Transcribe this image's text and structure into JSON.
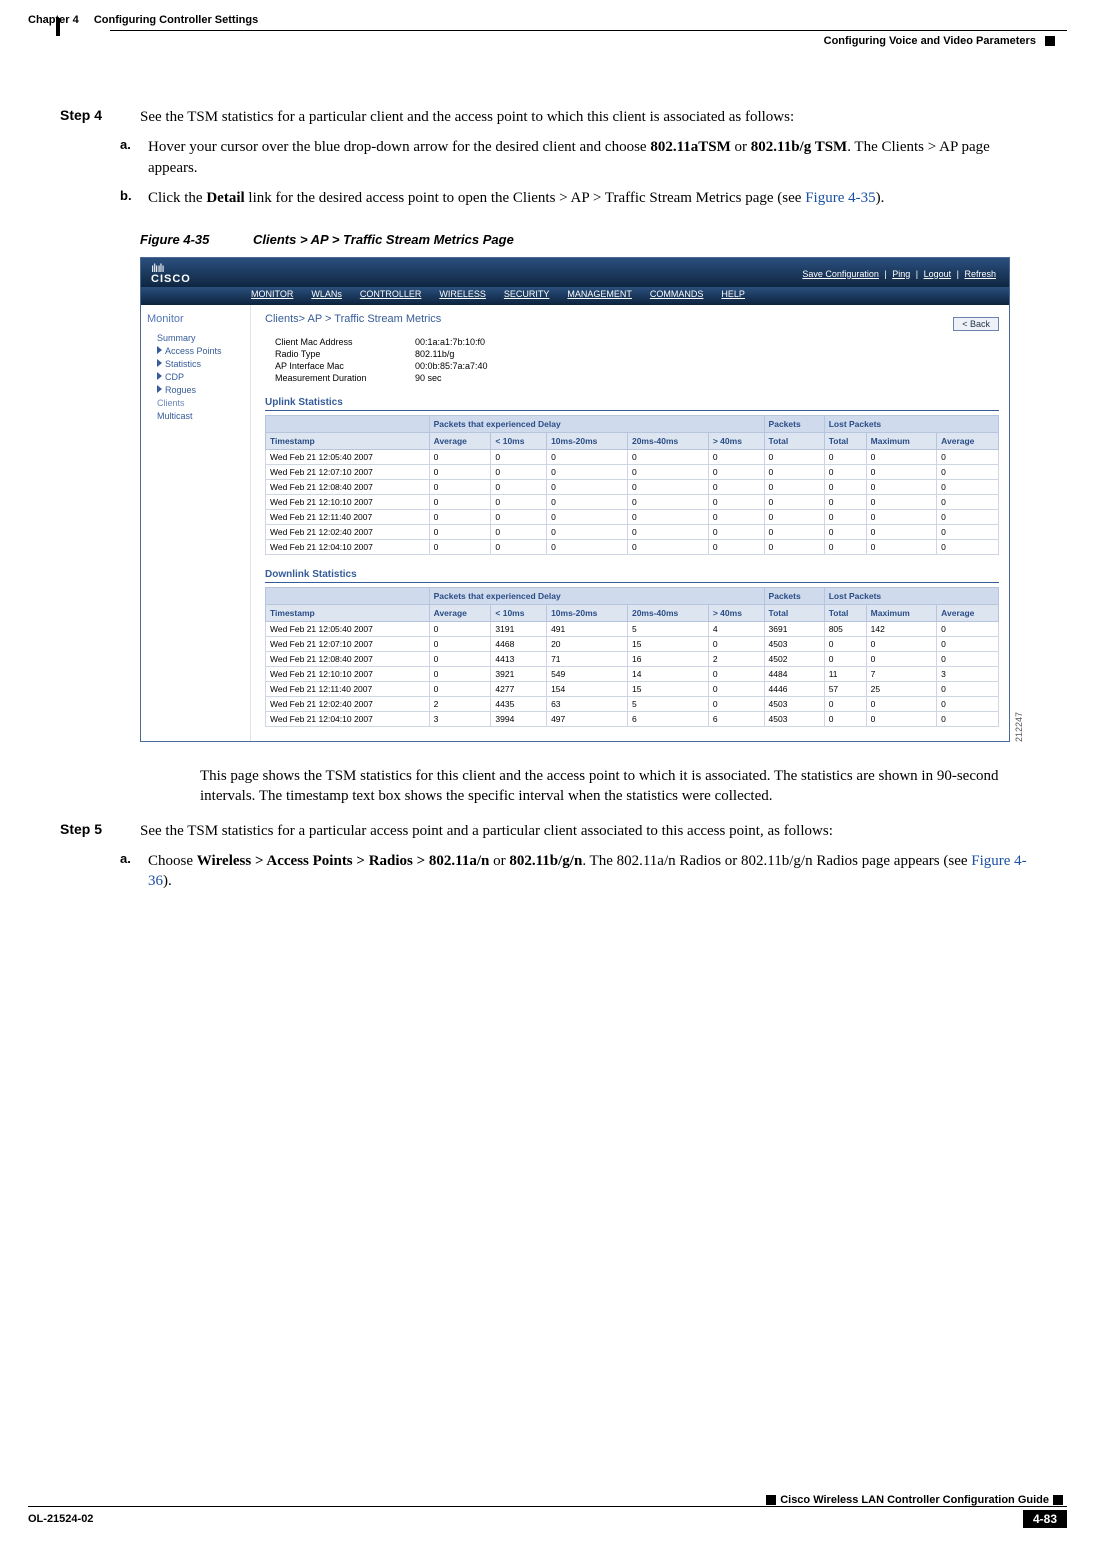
{
  "header": {
    "chapter": "Chapter 4",
    "title": "Configuring Controller Settings",
    "sub": "Configuring Voice and Video Parameters"
  },
  "step4": {
    "label": "Step 4",
    "text": "See the TSM statistics for a particular client and the access point to which this client is associated as follows:",
    "a_prefix": "Hover your cursor over the blue drop-down arrow for the desired client and choose ",
    "a_bold1": "802.11aTSM",
    "a_mid": " or ",
    "a_bold2": "802.11b/g TSM",
    "a_suffix": ". The Clients > AP page appears.",
    "b_prefix": "Click the ",
    "b_bold": "Detail",
    "b_mid": " link for the desired access point to open the Clients > AP > Traffic Stream Metrics page (see ",
    "b_link": "Figure 4-35",
    "b_suffix": ")."
  },
  "figure": {
    "num": "Figure 4-35",
    "caption": "Clients > AP > Traffic Stream Metrics Page",
    "id": "212247",
    "toplinks": {
      "save": "Save Configuration",
      "ping": "Ping",
      "logout": "Logout",
      "refresh": "Refresh"
    },
    "logo_bars": "ılıılı",
    "logo_text": "CISCO",
    "nav": [
      "MONITOR",
      "WLANs",
      "CONTROLLER",
      "WIRELESS",
      "SECURITY",
      "MANAGEMENT",
      "COMMANDS",
      "HELP"
    ],
    "side_title": "Monitor",
    "side_items": [
      "Summary",
      "Access Points",
      "Statistics",
      "CDP",
      "Rogues",
      "Clients",
      "Multicast"
    ],
    "crumb": "Clients> AP > Traffic Stream Metrics",
    "back": "< Back",
    "kv": [
      {
        "k": "Client Mac Address",
        "v": "00:1a:a1:7b:10:f0"
      },
      {
        "k": "Radio Type",
        "v": "802.11b/g"
      },
      {
        "k": "AP Interface Mac",
        "v": "00:0b:85:7a:a7:40"
      },
      {
        "k": "Measurement Duration",
        "v": "90 sec"
      }
    ],
    "uplink_title": "Uplink Statistics",
    "downlink_title": "Downlink Statistics",
    "group_headers": {
      "empty": "",
      "delay": "Packets that experienced Delay",
      "packets": "Packets",
      "lost": "Lost Packets"
    },
    "col_headers": [
      "Timestamp",
      "Average",
      "< 10ms",
      "10ms-20ms",
      "20ms-40ms",
      "> 40ms",
      "Total",
      "Total",
      "Maximum",
      "Average"
    ],
    "uplink_rows": [
      [
        "Wed Feb 21 12:05:40 2007",
        "0",
        "0",
        "0",
        "0",
        "0",
        "0",
        "0",
        "0",
        "0"
      ],
      [
        "Wed Feb 21 12:07:10 2007",
        "0",
        "0",
        "0",
        "0",
        "0",
        "0",
        "0",
        "0",
        "0"
      ],
      [
        "Wed Feb 21 12:08:40 2007",
        "0",
        "0",
        "0",
        "0",
        "0",
        "0",
        "0",
        "0",
        "0"
      ],
      [
        "Wed Feb 21 12:10:10 2007",
        "0",
        "0",
        "0",
        "0",
        "0",
        "0",
        "0",
        "0",
        "0"
      ],
      [
        "Wed Feb 21 12:11:40 2007",
        "0",
        "0",
        "0",
        "0",
        "0",
        "0",
        "0",
        "0",
        "0"
      ],
      [
        "Wed Feb 21 12:02:40 2007",
        "0",
        "0",
        "0",
        "0",
        "0",
        "0",
        "0",
        "0",
        "0"
      ],
      [
        "Wed Feb 21 12:04:10 2007",
        "0",
        "0",
        "0",
        "0",
        "0",
        "0",
        "0",
        "0",
        "0"
      ]
    ],
    "downlink_rows": [
      [
        "Wed Feb 21 12:05:40 2007",
        "0",
        "3191",
        "491",
        "5",
        "4",
        "3691",
        "805",
        "142",
        "0"
      ],
      [
        "Wed Feb 21 12:07:10 2007",
        "0",
        "4468",
        "20",
        "15",
        "0",
        "4503",
        "0",
        "0",
        "0"
      ],
      [
        "Wed Feb 21 12:08:40 2007",
        "0",
        "4413",
        "71",
        "16",
        "2",
        "4502",
        "0",
        "0",
        "0"
      ],
      [
        "Wed Feb 21 12:10:10 2007",
        "0",
        "3921",
        "549",
        "14",
        "0",
        "4484",
        "11",
        "7",
        "3"
      ],
      [
        "Wed Feb 21 12:11:40 2007",
        "0",
        "4277",
        "154",
        "15",
        "0",
        "4446",
        "57",
        "25",
        "0"
      ],
      [
        "Wed Feb 21 12:02:40 2007",
        "2",
        "4435",
        "63",
        "5",
        "0",
        "4503",
        "0",
        "0",
        "0"
      ],
      [
        "Wed Feb 21 12:04:10 2007",
        "3",
        "3994",
        "497",
        "6",
        "6",
        "4503",
        "0",
        "0",
        "0"
      ]
    ]
  },
  "after_fig": "This page shows the TSM statistics for this client and the access point to which it is associated. The statistics are shown in 90-second intervals. The timestamp text box shows the specific interval when the statistics were collected.",
  "step5": {
    "label": "Step 5",
    "text": "See the TSM statistics for a particular access point and a particular client associated to this access point, as follows:",
    "a_prefix": "Choose ",
    "a_bold1": "Wireless > Access Points > Radios > 802.11a/n",
    "a_mid": " or ",
    "a_bold2": "802.11b/g/n",
    "a_suffix1": ". The 802.11a/n Radios or 802.11b/g/n Radios page appears (see ",
    "a_link": "Figure 4-36",
    "a_suffix2": ")."
  },
  "footer": {
    "guide": "Cisco Wireless LAN Controller Configuration Guide",
    "doc": "OL-21524-02",
    "page": "4-83"
  }
}
